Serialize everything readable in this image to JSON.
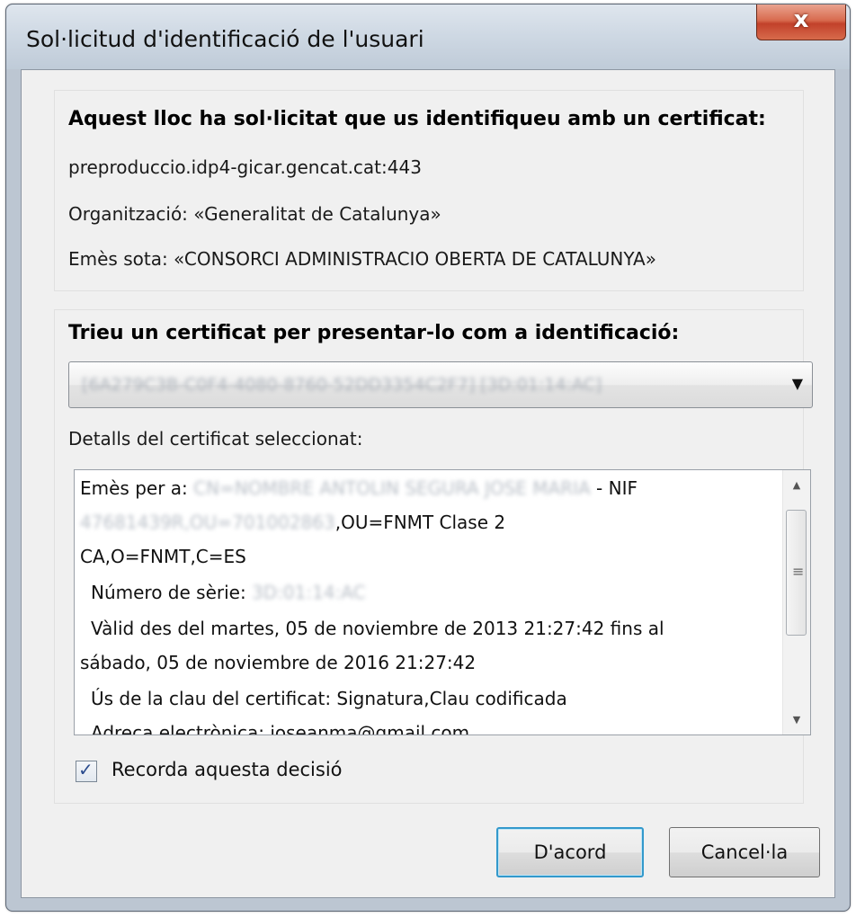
{
  "window": {
    "title": "Sol·licitud d'identificació de l'usuari",
    "close_label": "x"
  },
  "site_info": {
    "heading": "Aquest lloc ha sol·licitat que us identifiqueu amb un certificat:",
    "host": "preproduccio.idp4-gicar.gencat.cat:443",
    "organization": "Organització: «Generalitat de Catalunya»",
    "issued_under": "Emès sota: «CONSORCI ADMINISTRACIO OBERTA DE CATALUNYA»"
  },
  "certificate": {
    "heading": "Trieu un certificat per presentar-lo com a identificació:",
    "selected": "[6A279C3B-C0F4-4080-8760-52DD3354C2F7] [3D:01:14:AC]",
    "details_label": "Detalls del certificat seleccionat:",
    "details": {
      "issued_to_prefix": "Emès per a: ",
      "issued_to_blurred": "CN=NOMBRE ANTOLIN SEGURA JOSE MARIA",
      "issued_to_suffix": " - NIF",
      "line2_blurred": "47681439R,OU=701002863",
      "line2_suffix": ",OU=FNMT Clase 2",
      "line3": "CA,O=FNMT,C=ES",
      "serial_prefix": "Número de sèrie: ",
      "serial_blurred": "3D:01:14:AC",
      "valid_line1": "Vàlid des del martes, 05 de noviembre de 2013 21:27:42 fins al",
      "valid_line2": "sábado, 05 de noviembre de 2016 21:27:42",
      "key_usage": "Ús de la clau del certificat: Signatura,Clau codificada",
      "email_partial": "Adreça electrònica: joseanma@gmail.com"
    }
  },
  "remember": {
    "label": "Recorda aquesta decisió",
    "checked": true
  },
  "buttons": {
    "ok": "D'acord",
    "cancel": "Cancel·la"
  }
}
